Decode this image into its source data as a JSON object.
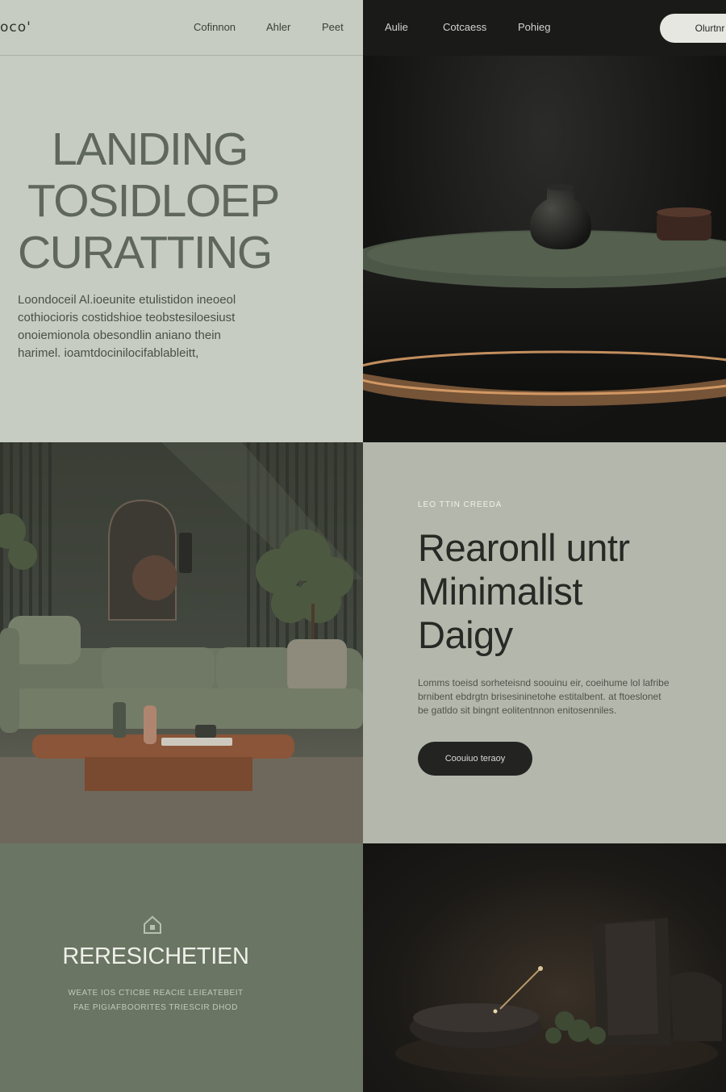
{
  "nav": {
    "logo": "oco'",
    "links": [
      "Cofinnon",
      "Ahler",
      "Peet",
      "Aulie",
      "Cotcaess",
      "Pohieg"
    ],
    "cta": "Olurtnr"
  },
  "hero": {
    "title_lines": [
      "LANDING",
      "TOSIDLOEP",
      "CURATTING"
    ],
    "text_lines": [
      "Loondoceil Al.ioeunite etulistidon ineoeol",
      "cothiocioris costidshioe teobstesiloesiust",
      "onoiemionola obesondlin aniano thein",
      "harimel. ioamtdocinilocifablableitt,"
    ]
  },
  "minimal": {
    "eyebrow": "LEO TTIN CREEDA",
    "title_lines": [
      "Rearonll untr",
      "Minimalist",
      "Daigy"
    ],
    "text_lines": [
      "Lomms toeisd sorheteisnd soouinu eir, coeihume lol lafribe",
      "brnibent ebdrgtn brisesininetohe estitalbent. at ftoeslonet",
      "be gatldo sit bingnt eolitentnnon enitosenniles."
    ],
    "button": "Coouiuo teraoy"
  },
  "resi": {
    "title": "RERESICHETIEN",
    "lines": [
      "WEATE IOS CTICBE REACIE LEIEATEBEIT",
      "FAE PIGIAFBOORITES TRIESCIR DHOD"
    ]
  },
  "colors": {
    "sage": "#c6ccc1",
    "dark": "#1a1a18",
    "olive": "#6a7563",
    "stone": "#b4b8ac"
  },
  "icons": [
    "home-icon"
  ]
}
